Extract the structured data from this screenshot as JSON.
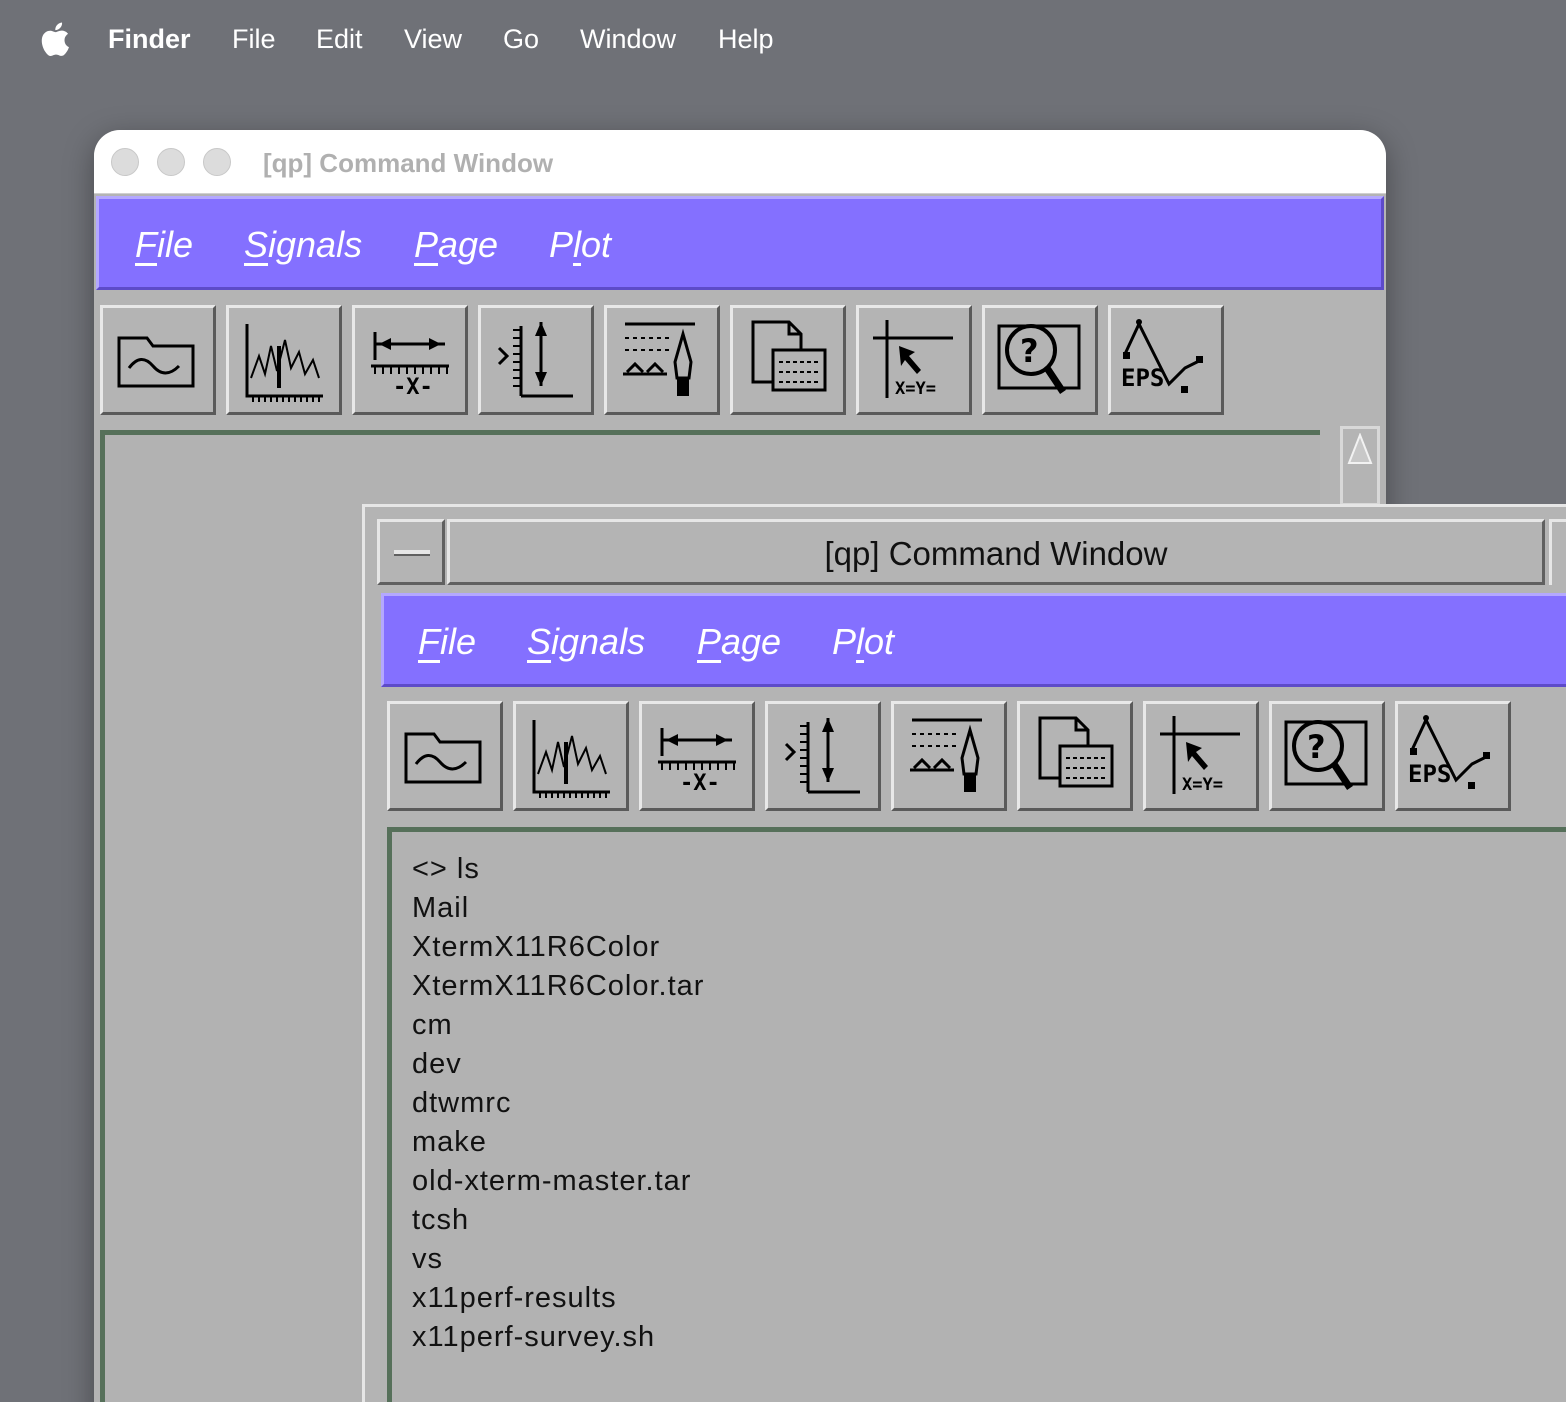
{
  "mac_menubar": {
    "app_name": "Finder",
    "items": [
      "File",
      "Edit",
      "View",
      "Go",
      "Window",
      "Help"
    ]
  },
  "back_window": {
    "title": "[qp] Command Window",
    "menu": [
      {
        "label": "File",
        "mnemonic": "F",
        "rest": "ile"
      },
      {
        "label": "Signals",
        "mnemonic": "S",
        "rest": "ignals"
      },
      {
        "label": "Page",
        "mnemonic": "P",
        "rest": "age"
      },
      {
        "label": "Plot",
        "pre": "P",
        "mnemonic": "l",
        "rest": "ot"
      }
    ]
  },
  "front_window": {
    "title": "[qp] Command Window",
    "menu": [
      {
        "label": "File",
        "mnemonic": "F",
        "rest": "ile"
      },
      {
        "label": "Signals",
        "mnemonic": "S",
        "rest": "ignals"
      },
      {
        "label": "Page",
        "mnemonic": "P",
        "rest": "age"
      },
      {
        "label": "Plot",
        "pre": "P",
        "mnemonic": "l",
        "rest": "ot"
      }
    ],
    "console_lines": [
      "<> ls",
      "Mail",
      "XtermX11R6Color",
      "XtermX11R6Color.tar",
      "cm",
      "dev",
      "dtwmrc",
      "make",
      "old-xterm-master.tar",
      "tcsh",
      "vs",
      "x11perf-results",
      "x11perf-survey.sh"
    ]
  },
  "toolbar_icons": [
    {
      "name": "open-signal-icon"
    },
    {
      "name": "plot-signals-icon"
    },
    {
      "name": "x-axis-range-icon"
    },
    {
      "name": "y-axis-range-icon"
    },
    {
      "name": "annotate-pen-icon"
    },
    {
      "name": "print-page-icon"
    },
    {
      "name": "cursor-xy-readout-icon"
    },
    {
      "name": "query-zoom-icon"
    },
    {
      "name": "eps-export-icon",
      "label": "EPS"
    }
  ],
  "colors": {
    "desktop": "#6f7177",
    "motif_menu": "#8470ff",
    "window_bg": "#b4b4b4",
    "frame_border": "#56705a"
  }
}
